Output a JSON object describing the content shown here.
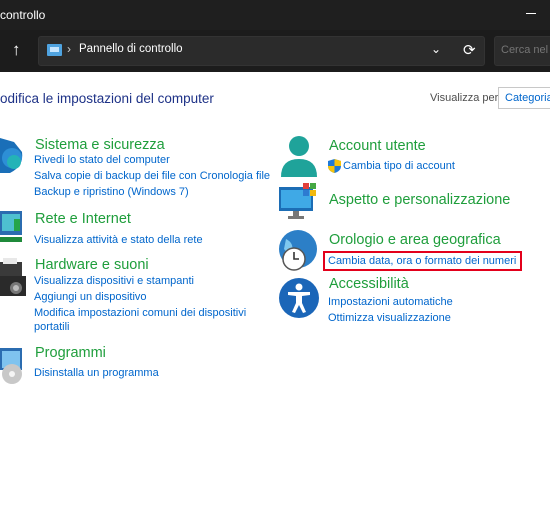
{
  "window": {
    "title": "controllo"
  },
  "address": {
    "path": "Pannello di controllo",
    "search_placeholder": "Cerca nel Pa"
  },
  "header": {
    "title": "odifica le impostazioni del computer",
    "view_label": "Visualizza per:",
    "view_value": "Categoria"
  },
  "left_categories": [
    {
      "title": "Sistema e sicurezza",
      "icon": "shield-icon",
      "links": [
        "Rivedi lo stato del computer",
        "Salva copie di backup dei file con Cronologia file",
        "Backup e ripristino (Windows 7)"
      ]
    },
    {
      "title": "Rete e Internet",
      "icon": "network-icon",
      "links": [
        "Visualizza attività e stato della rete"
      ]
    },
    {
      "title": "Hardware e suoni",
      "icon": "printer-icon",
      "links": [
        "Visualizza dispositivi e stampanti",
        "Aggiungi un dispositivo",
        "Modifica impostazioni comuni dei dispositivi",
        "portatili"
      ]
    },
    {
      "title": "Programmi",
      "icon": "programs-icon",
      "links": [
        "Disinstalla un programma"
      ]
    }
  ],
  "right_categories": [
    {
      "title": "Account utente",
      "icon": "user-icon",
      "links": [
        "Cambia tipo di account"
      ]
    },
    {
      "title": "Aspetto e personalizzazione",
      "icon": "display-icon",
      "links": []
    },
    {
      "title": "Orologio e area geografica",
      "icon": "clock-globe-icon",
      "links": [
        "Cambia data, ora o formato dei numeri"
      ]
    },
    {
      "title": "Accessibilità",
      "icon": "accessibility-icon",
      "links": [
        "Impostazioni automatiche",
        "Ottimizza visualizzazione"
      ]
    }
  ],
  "colors": {
    "category_title": "#1f9e3c",
    "link": "#0066cc",
    "highlight": "#e3001b",
    "titlebar": "#1f1f1f"
  }
}
